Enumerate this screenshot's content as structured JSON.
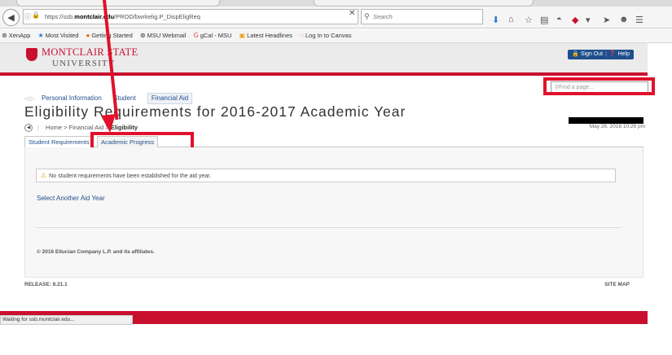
{
  "browser": {
    "url_prefix": "https://ssb.",
    "url_host": "montclair.edu",
    "url_path": "/PROD/bwrkelig.P_DispEligReq",
    "search_placeholder": "Search",
    "bookmarks": [
      {
        "label": "XenApp",
        "icon": "citrix-icon"
      },
      {
        "label": "Most Visited",
        "icon": "star-icon"
      },
      {
        "label": "Getting Started",
        "icon": "firefox-icon"
      },
      {
        "label": "MSU Webmail",
        "icon": "globe-icon"
      },
      {
        "label": "gCal - MSU",
        "icon": "google-icon"
      },
      {
        "label": "Latest Headlines",
        "icon": "rss-icon"
      },
      {
        "label": "Log In to Canvas",
        "icon": "canvas-icon"
      }
    ],
    "status_text": "Waiting for ssb.montclair.edu..."
  },
  "header": {
    "logo_name": "MONTCLAIR STATE",
    "logo_sub": "UNIVERSITY",
    "sign_out_label": "Sign Out",
    "help_label": "Help"
  },
  "find": {
    "placeholder": "Find a page..."
  },
  "top_tabs": [
    {
      "label": "Personal Information"
    },
    {
      "label": "Student"
    },
    {
      "label": "Financial Aid"
    }
  ],
  "page": {
    "title": "Eligibility Requirements for 2016-2017 Academic Year",
    "timestamp": "May 26, 2016 10:26 pm",
    "breadcrumb": {
      "home": "Home",
      "parent": "Financial Aid",
      "current": "Eligibility"
    }
  },
  "sub_tabs": [
    {
      "label": "Student Requirements"
    },
    {
      "label": "Academic Progress"
    }
  ],
  "main": {
    "info_message": "No student requirements have been established for the aid year.",
    "select_link": "Select Another Aid Year",
    "copyright": "© 2016 Ellucian Company L.P. and its affiliates."
  },
  "footer": {
    "release": "RELEASE: 8.21.1",
    "site_map": "SITE MAP"
  },
  "colors": {
    "accent_red": "#c8102e",
    "annotation_red": "#e0112b",
    "link_blue": "#1f4e8c"
  }
}
